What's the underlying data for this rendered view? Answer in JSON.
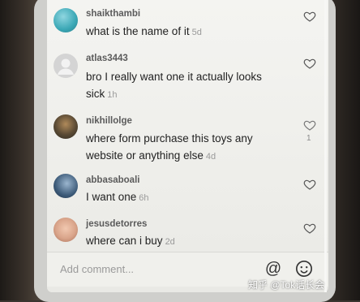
{
  "comments": [
    {
      "username": "shaikthambi",
      "text": "what is the name of it",
      "age": "5d",
      "likes": "",
      "avatar_color": "#3aa7b5"
    },
    {
      "username": "atlas3443",
      "text": "bro I really want one it actually looks sick",
      "age": "1h",
      "likes": "",
      "avatar_color": "#c9c9c9"
    },
    {
      "username": "nikhillolge",
      "text": "where form purchase this toys any website or anything else",
      "age": "4d",
      "likes": "1",
      "avatar_color": "#4b4a3a"
    },
    {
      "username": "abbasaboali",
      "text": "I want one",
      "age": "6h",
      "likes": "",
      "avatar_color": "#3c5a78"
    },
    {
      "username": "jesusdetorres",
      "text": "where can i buy",
      "age": "2d",
      "likes": "",
      "avatar_color": "#d9a48a"
    }
  ],
  "input": {
    "placeholder": "Add comment..."
  },
  "icons": {
    "mention": "at-icon",
    "emoji": "emoji-icon",
    "like": "heart-icon"
  },
  "watermark": "知乎 @T",
  "watermark_tail": "ok话长会"
}
